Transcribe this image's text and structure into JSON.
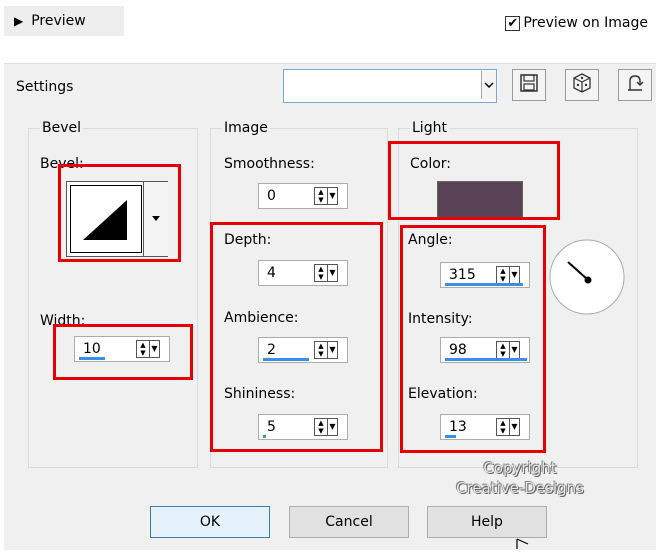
{
  "preview": {
    "label": "Preview",
    "preview_on_image_label": "Preview on Image",
    "preview_on_image_checked": true
  },
  "settings": {
    "label": "Settings",
    "combo_value": ""
  },
  "bevel": {
    "group_title": "Bevel",
    "bevel_label": "Bevel:",
    "width_label": "Width:",
    "width_value": "10"
  },
  "image": {
    "group_title": "Image",
    "smoothness_label": "Smoothness:",
    "smoothness_value": "0",
    "depth_label": "Depth:",
    "depth_value": "4",
    "ambience_label": "Ambience:",
    "ambience_value": "2",
    "shininess_label": "Shininess:",
    "shininess_value": "5"
  },
  "light": {
    "group_title": "Light",
    "color_label": "Color:",
    "color_value": "#5a4257",
    "angle_label": "Angle:",
    "angle_value": "315",
    "intensity_label": "Intensity:",
    "intensity_value": "98",
    "elevation_label": "Elevation:",
    "elevation_value": "13"
  },
  "watermark": {
    "line1": "Copyright",
    "line2": "Creative-Designs"
  },
  "buttons": {
    "ok": "OK",
    "cancel": "Cancel",
    "help": "Help"
  },
  "icons": [
    "save-icon",
    "randomize-icon",
    "reset-icon"
  ]
}
